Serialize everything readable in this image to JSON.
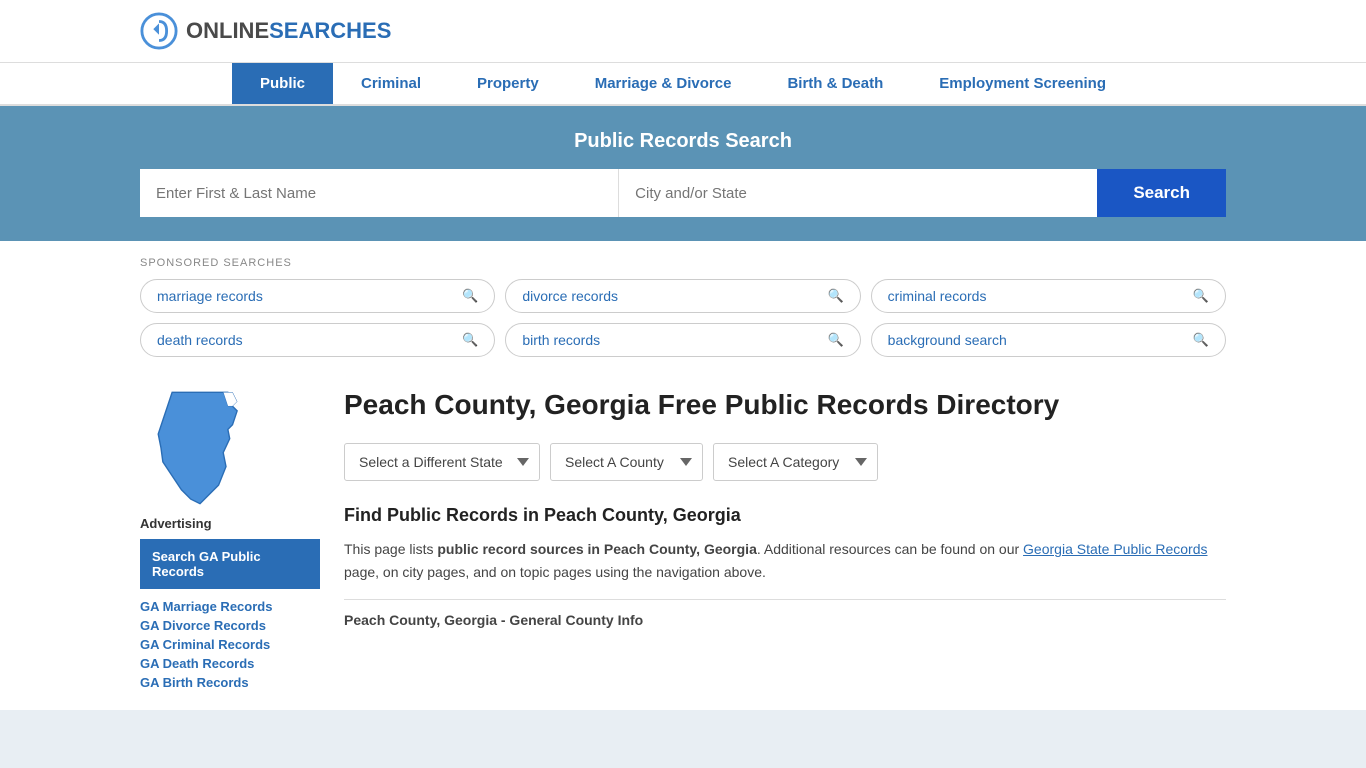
{
  "header": {
    "logo_brand": "ONLINE",
    "logo_brand2": "SEARCHES"
  },
  "nav": {
    "items": [
      {
        "label": "Public",
        "active": true
      },
      {
        "label": "Criminal",
        "active": false
      },
      {
        "label": "Property",
        "active": false
      },
      {
        "label": "Marriage & Divorce",
        "active": false
      },
      {
        "label": "Birth & Death",
        "active": false
      },
      {
        "label": "Employment Screening",
        "active": false
      }
    ]
  },
  "search_banner": {
    "title": "Public Records Search",
    "name_placeholder": "Enter First & Last Name",
    "location_placeholder": "City and/or State",
    "button_label": "Search"
  },
  "sponsored": {
    "label": "SPONSORED SEARCHES",
    "pills": [
      "marriage records",
      "divorce records",
      "criminal records",
      "death records",
      "birth records",
      "background search"
    ]
  },
  "sidebar": {
    "ad_label": "Advertising",
    "ad_box_text": "Search GA Public Records",
    "links": [
      "GA Marriage Records",
      "GA Divorce Records",
      "GA Criminal Records",
      "GA Death Records",
      "GA Birth Records"
    ]
  },
  "page": {
    "title": "Peach County, Georgia Free Public Records Directory",
    "dropdown_state": "Select a Different State",
    "dropdown_county": "Select A County",
    "dropdown_category": "Select A Category",
    "find_title": "Find Public Records in Peach County, Georgia",
    "desc_part1": "This page lists ",
    "desc_bold": "public record sources in Peach County, Georgia",
    "desc_part2": ". Additional resources can be found on our ",
    "desc_link": "Georgia State Public Records",
    "desc_part3": " page, on city pages, and on topic pages using the navigation above.",
    "county_section_label": "Peach County, Georgia - General County Info"
  }
}
